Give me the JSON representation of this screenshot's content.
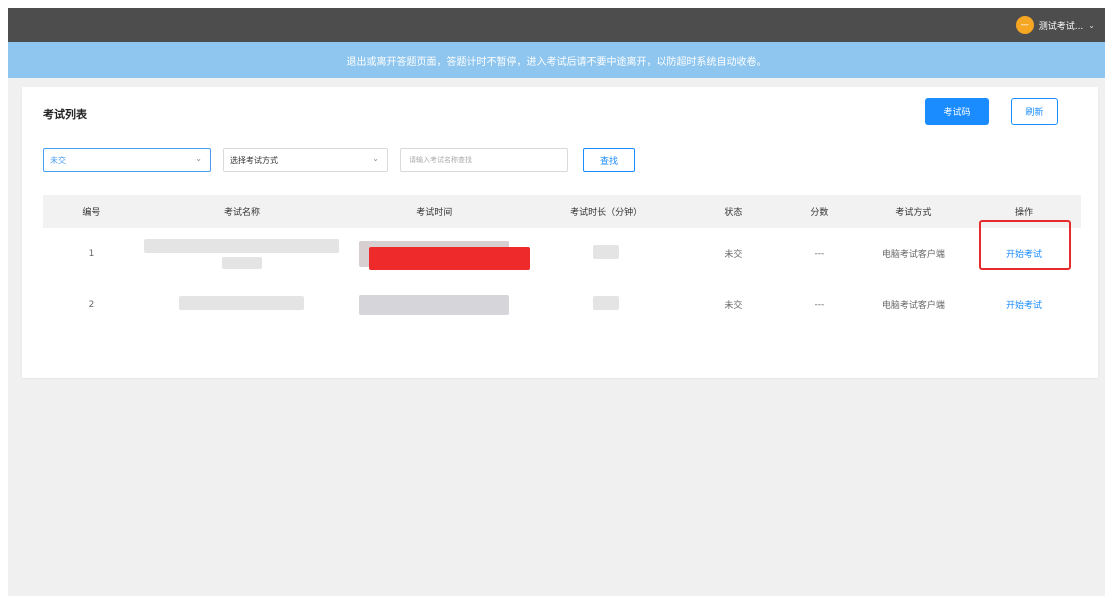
{
  "header": {
    "user_name": "测试考试...",
    "avatar_text": "一"
  },
  "notice": {
    "text": "退出或离开答题页面，答题计时不暂停，进入考试后请不要中途离开，以防超时系统自动收卷。"
  },
  "page": {
    "title": "考试列表",
    "exam_code_button": "考试码",
    "refresh_button": "刷新"
  },
  "filters": {
    "status_value": "未交",
    "mode_value": "选择考试方式",
    "search_placeholder": "请输入考试名称查找",
    "search_button": "查找"
  },
  "table": {
    "columns": [
      "编号",
      "考试名称",
      "考试时间",
      "考试时长（分钟）",
      "状态",
      "分数",
      "考试方式",
      "操作"
    ],
    "rows": [
      {
        "num": "1",
        "status": "未交",
        "score": "---",
        "mode": "电脑考试客户端",
        "action": "开始考试"
      },
      {
        "num": "2",
        "status": "未交",
        "score": "---",
        "mode": "电脑考试客户端",
        "action": "开始考试"
      }
    ]
  },
  "colors": {
    "accent": "#1a8cff",
    "notice_bg": "#8ec6ef",
    "topbar_bg": "#4d4d4d",
    "highlight": "#e52b2b"
  }
}
